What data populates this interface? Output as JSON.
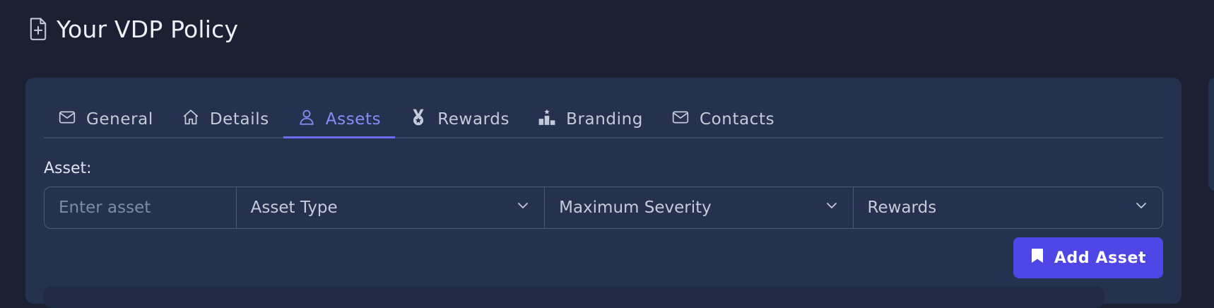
{
  "page": {
    "title": "Your VDP Policy",
    "icon": "file-plus-icon"
  },
  "tabs": [
    {
      "label": "General",
      "icon": "mail-icon",
      "active": false
    },
    {
      "label": "Details",
      "icon": "home-icon",
      "active": false
    },
    {
      "label": "Assets",
      "icon": "user-icon",
      "active": true
    },
    {
      "label": "Rewards",
      "icon": "medal-icon",
      "active": false
    },
    {
      "label": "Branding",
      "icon": "podium-icon",
      "active": false
    },
    {
      "label": "Contacts",
      "icon": "mail-icon",
      "active": false
    }
  ],
  "asset_form": {
    "label": "Asset:",
    "asset_placeholder": "Enter asset",
    "asset_type": "Asset Type",
    "maximum_severity": "Maximum Severity",
    "rewards": "Rewards",
    "add_button": "Add Asset"
  },
  "colors": {
    "background": "#1b2033",
    "card": "#243250",
    "accent": "#4e46e5",
    "active_tab": "#8a8cf7"
  }
}
